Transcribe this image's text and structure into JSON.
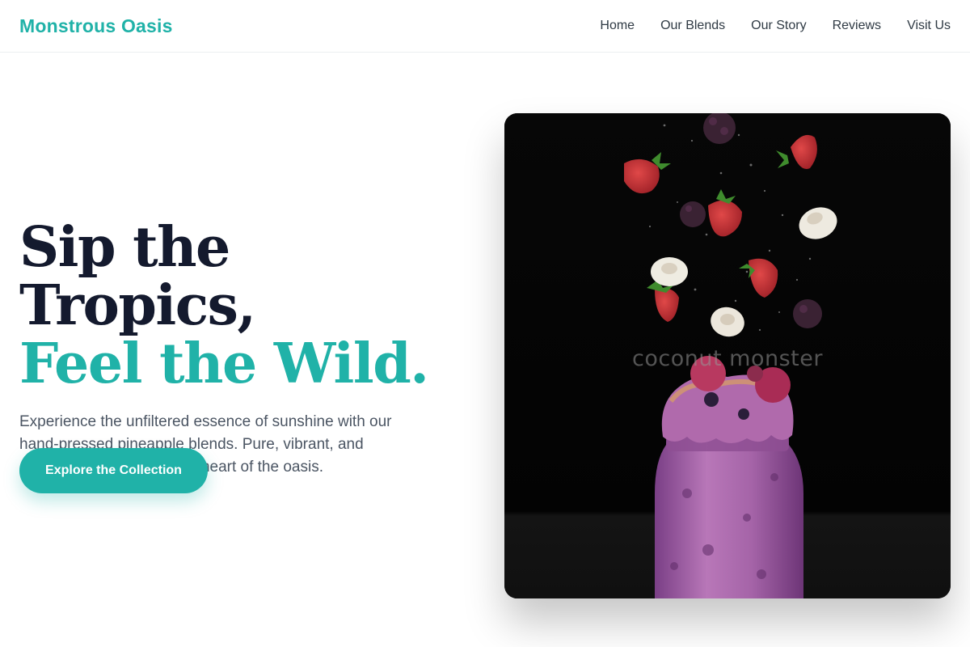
{
  "brand": {
    "name": "Monstrous Oasis",
    "accent": "#20b2a8",
    "ink": "#141a2e"
  },
  "nav": {
    "items": [
      {
        "label": "Home"
      },
      {
        "label": "Our Blends"
      },
      {
        "label": "Our Story"
      },
      {
        "label": "Reviews"
      },
      {
        "label": "Visit Us"
      }
    ]
  },
  "hero": {
    "headline_line1": "Sip the Tropics,",
    "headline_line2": "Feel the Wild.",
    "description": "Experience the unfiltered essence of sunshine with our hand-pressed pineapple blends. Pure, vibrant, and delivered straight from the heart of the oasis.",
    "cta_label": "Explore the Collection"
  },
  "image": {
    "caption": "coconut monster",
    "subject": "purple berry smoothie jar with falling strawberries, blackberries and banana slices"
  }
}
